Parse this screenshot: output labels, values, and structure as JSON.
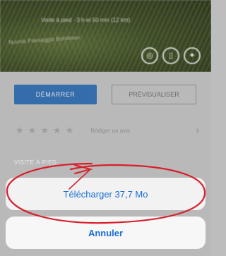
{
  "hero": {
    "subtitle": "Visite à pied · 3 h et 50 min (12 km)",
    "caption": "Nuvola Paesaggio Bordeaux",
    "icons": [
      "compass-icon",
      "bookmark-icon",
      "settings-icon"
    ]
  },
  "actions": {
    "start_label": "DÉMARRER",
    "preview_label": "PRÉVISUALISER"
  },
  "rating": {
    "stars": 5,
    "text": "Rédiger un avis"
  },
  "section": {
    "label": "VISITÉ À PIED"
  },
  "action_sheet": {
    "download_label": "Télécharger 37,7 Mo",
    "cancel_label": "Annuler"
  },
  "colors": {
    "primary": "#1f5fa8",
    "link": "#1a6fd6",
    "annotation": "#d81f2b"
  }
}
